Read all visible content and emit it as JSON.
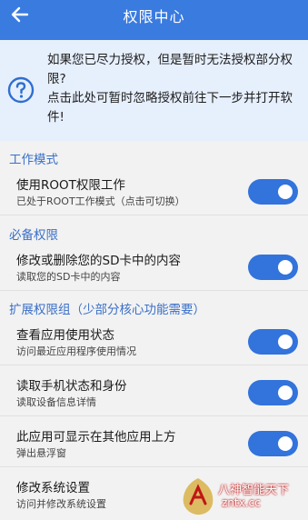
{
  "appbar": {
    "title": "权限中心",
    "back_icon": "back-arrow-icon"
  },
  "notice": {
    "icon": "help-circle-icon",
    "line1": "如果您已尽力授权，但是暂时无法授权部分权",
    "line2": "限?",
    "line3": "点击此处可暂时忽略授权前往下一步并打开软",
    "line4": "件!"
  },
  "sections": {
    "work_mode": "工作模式",
    "required": "必备权限",
    "extended": "扩展权限组（少部分核心功能需要）"
  },
  "rows": {
    "root": {
      "title": "使用ROOT权限工作",
      "subtitle": "已处于ROOT工作模式（点击可切换）",
      "enabled": true
    },
    "sd": {
      "title": "修改或删除您的SD卡中的内容",
      "subtitle": "读取您的SD卡中的内容",
      "enabled": true
    },
    "usage": {
      "title": "查看应用使用状态",
      "subtitle": "访问最近应用程序使用情况",
      "enabled": true
    },
    "phone": {
      "title": "读取手机状态和身份",
      "subtitle": "读取设备信息详情",
      "enabled": true
    },
    "overlay": {
      "title": "此应用可显示在其他应用上方",
      "subtitle": "弹出悬浮窗",
      "enabled": true
    },
    "settings": {
      "title": "修改系统设置",
      "subtitle": "访问并修改系统设置"
    }
  },
  "watermark": {
    "name": "八神智能天下",
    "url": "zntx.cc"
  },
  "colors": {
    "primary": "#3a7bdf",
    "toggle_on": "#3273dc",
    "section_text": "#3a6fc8",
    "notice_bg": "#e6effc"
  }
}
